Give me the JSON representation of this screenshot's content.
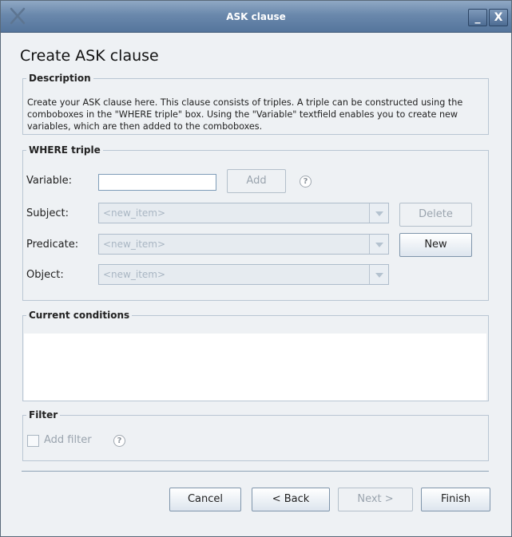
{
  "window": {
    "title": "ASK clause",
    "minimize_label": "_",
    "close_label": "X"
  },
  "heading": "Create ASK clause",
  "description": {
    "legend": "Description",
    "text": "Create your ASK clause here. This clause consists of triples. A triple can be constructed using the comboboxes in the \"WHERE triple\" box. Using the \"Variable\" textfield enables you to create new variables, which are then added to the comboboxes."
  },
  "where": {
    "legend": "WHERE triple",
    "variable_label": "Variable:",
    "variable_value": "",
    "add_label": "Add",
    "help_glyph": "?",
    "subject_label": "Subject:",
    "subject_value": "<new_item>",
    "predicate_label": "Predicate:",
    "predicate_value": "<new_item>",
    "object_label": "Object:",
    "object_value": "<new_item>",
    "delete_label": "Delete",
    "new_label": "New"
  },
  "conditions": {
    "legend": "Current conditions",
    "items": []
  },
  "filter": {
    "legend": "Filter",
    "add_filter_label": "Add filter",
    "help_glyph": "?"
  },
  "footer": {
    "cancel_label": "Cancel",
    "back_label": "< Back",
    "next_label": "Next >",
    "finish_label": "Finish"
  }
}
